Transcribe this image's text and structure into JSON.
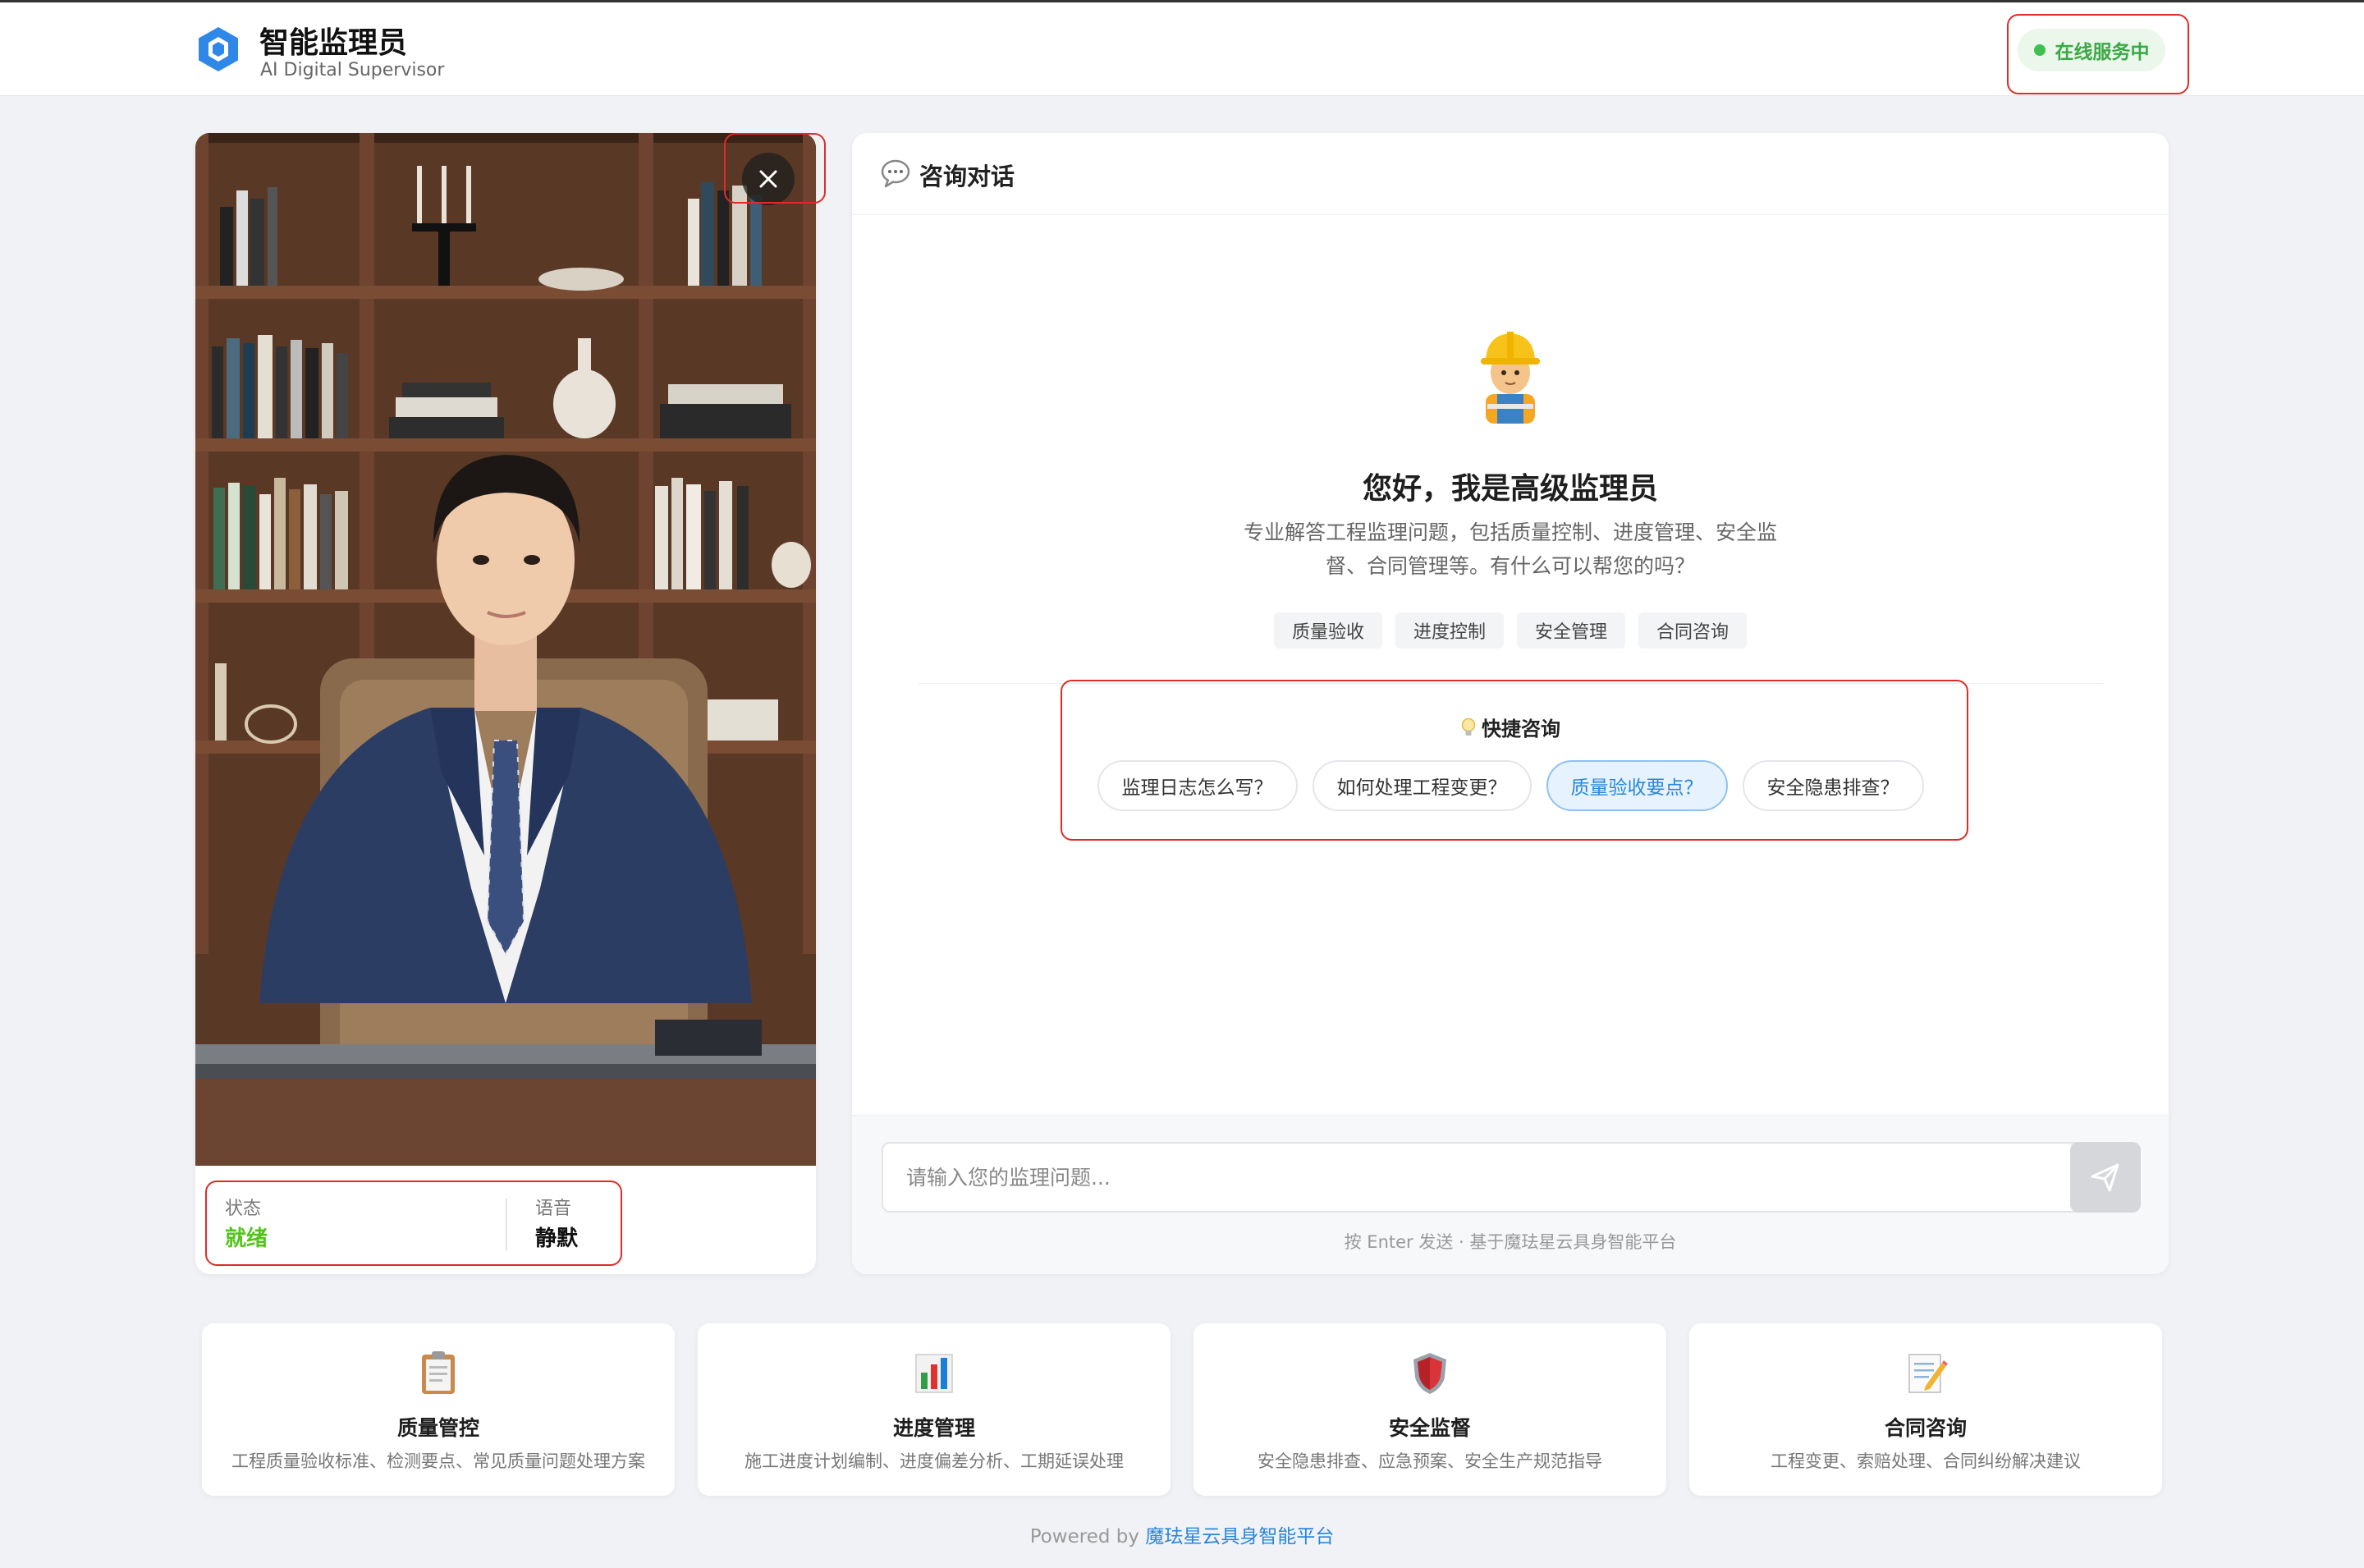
{
  "header": {
    "title": "智能监理员",
    "subtitle": "AI Digital Supervisor",
    "status": "在线服务中"
  },
  "avatar_panel": {
    "status_label": "状态",
    "status_value": "就绪",
    "voice_label": "语音",
    "voice_value": "静默"
  },
  "chat": {
    "title": "咨询对话",
    "greeting": "您好，我是高级监理员",
    "description": "专业解答工程监理问题，包括质量控制、进度管理、安全监督、合同管理等。有什么可以帮您的吗？",
    "tags": [
      "质量验收",
      "进度控制",
      "安全管理",
      "合同咨询"
    ],
    "quick_title": "快捷咨询",
    "quick_questions": [
      "监理日志怎么写？",
      "如何处理工程变更？",
      "质量验收要点？",
      "安全隐患排查？"
    ],
    "input_placeholder": "请输入您的监理问题...",
    "hint": "按 Enter 发送 · 基于魔珐星云具身智能平台"
  },
  "cards": [
    {
      "title": "质量管控",
      "desc": "工程质量验收标准、检测要点、常见质量问题处理方案",
      "icon": "clipboard-icon"
    },
    {
      "title": "进度管理",
      "desc": "施工进度计划编制、进度偏差分析、工期延误处理",
      "icon": "bar-chart-icon"
    },
    {
      "title": "安全监督",
      "desc": "安全隐患排查、应急预案、安全生产规范指导",
      "icon": "shield-icon"
    },
    {
      "title": "合同咨询",
      "desc": "工程变更、索赔处理、合同纠纷解决建议",
      "icon": "memo-icon"
    }
  ],
  "footer": {
    "prefix": "Powered by",
    "link": "魔珐星云具身智能平台"
  },
  "colors": {
    "accent": "#2a86db",
    "online": "#3aa845",
    "ready": "#52c41a",
    "highlight_box": "#e02a2a"
  }
}
